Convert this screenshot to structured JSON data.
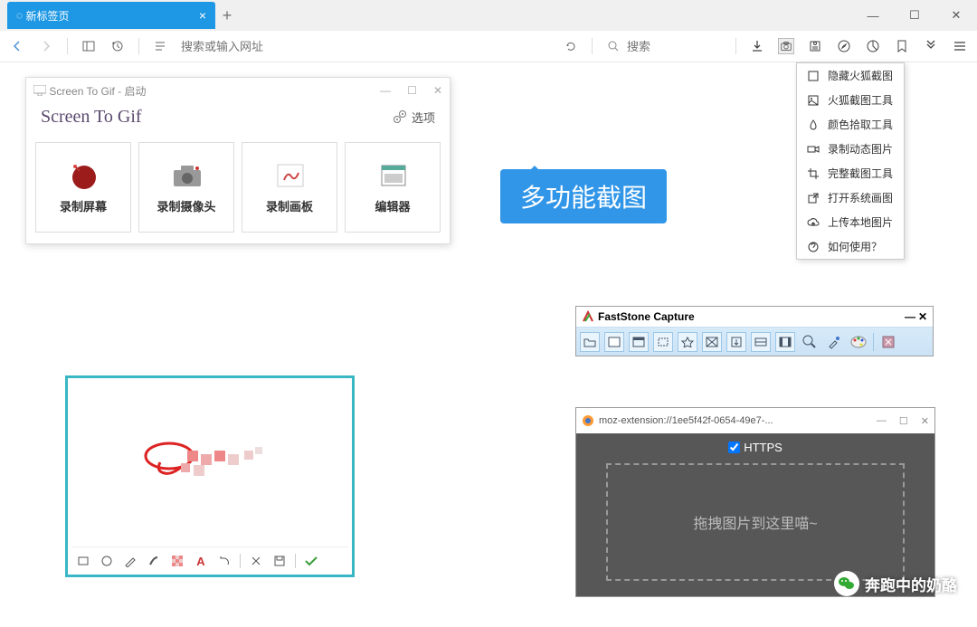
{
  "browser": {
    "tab_title": "新标签页",
    "new_tab": "+",
    "address_placeholder": "搜索或输入网址",
    "search_placeholder": "搜索"
  },
  "ext": {
    "items": [
      "隐藏火狐截图",
      "火狐截图工具",
      "颜色拾取工具",
      "录制动态图片",
      "完整截图工具",
      "打开系统画图",
      "上传本地图片",
      "如何使用？"
    ]
  },
  "stg": {
    "title": "Screen To Gif - 启动",
    "logo": "Screen To Gif",
    "options": "选项",
    "cards": [
      "录制屏幕",
      "录制摄像头",
      "录制画板",
      "编辑器"
    ]
  },
  "badge": {
    "text": "多功能截图"
  },
  "canvas": {
    "tools": [
      "rect",
      "circle",
      "pencil",
      "brush",
      "grid",
      "text",
      "redo",
      "sep",
      "del",
      "save",
      "sep",
      "check"
    ]
  },
  "fs": {
    "title": "FastStone Capture"
  },
  "moz": {
    "url": "moz-extension://1ee5f42f-0654-49e7-...",
    "https": "HTTPS",
    "drop": "拖拽图片到这里喵~"
  },
  "watermark": {
    "text": "奔跑中的奶酪"
  }
}
